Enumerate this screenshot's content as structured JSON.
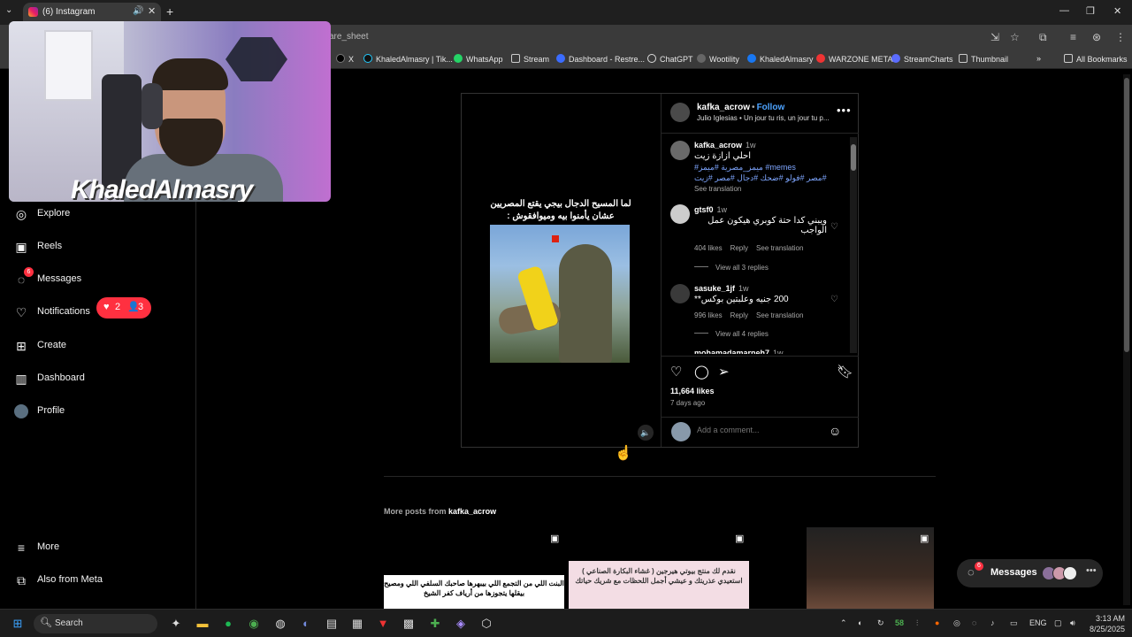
{
  "browser": {
    "tab_title": "(6) Instagram",
    "url_fragment": "are_sheet",
    "bookmarks": [
      "X",
      "KhaledAlmasry | Tik...",
      "WhatsApp",
      "Stream",
      "Dashboard - Restre...",
      "ChatGPT",
      "Wootility",
      "KhaledAlmasry",
      "WARZONE META",
      "StreamCharts",
      "Thumbnail"
    ],
    "all_bookmarks": "All Bookmarks"
  },
  "webcam": {
    "overlay_name": "KhaledAlmasry"
  },
  "sidebar": {
    "items": [
      {
        "label": "Explore",
        "icon": "compass-icon"
      },
      {
        "label": "Reels",
        "icon": "reels-icon"
      },
      {
        "label": "Messages",
        "icon": "messenger-icon",
        "badge": "6"
      },
      {
        "label": "Notifications",
        "icon": "heart-icon"
      },
      {
        "label": "Create",
        "icon": "plus-square-icon"
      },
      {
        "label": "Dashboard",
        "icon": "dashboard-icon"
      },
      {
        "label": "Profile",
        "icon": "avatar"
      }
    ],
    "notif_pill": {
      "likes": "2",
      "follows": "3"
    },
    "more": "More",
    "also_from_meta": "Also from Meta"
  },
  "post": {
    "media_caption": "لما المسيح الدجال بيجي يقتع المصريين عشان يأمنوا بيه وميوافقوش :",
    "author": "kafka_acrow",
    "follow": "Follow",
    "audio": "Julio Iglesias • Un jour tu ris, un jour tu p...",
    "caption": {
      "user": "kafka_acrow",
      "time": "1w",
      "text": "احلي ازازة زيت",
      "tags1": "#ميمز_مصرية #ميمز #memes",
      "tags2": "مصر #فولو #ضحك #دجال #مصر #زيت#",
      "see_translation": "See translation"
    },
    "comments": [
      {
        "user": "gtsf0",
        "time": "1w",
        "text": "ويبني كدا حتة كوبري هيكون عمل الواجب",
        "likes": "404 likes",
        "reply": "Reply",
        "translate": "See translation",
        "replies": "View all 3 replies"
      },
      {
        "user": "sasuke_1jf",
        "time": "1w",
        "text": "200 جنيه وعلبتين بوكس**",
        "likes": "996 likes",
        "reply": "Reply",
        "translate": "See translation",
        "replies": "View all 4 replies"
      },
      {
        "user": "mohamadamarneh7",
        "time": "1w"
      }
    ],
    "likes": "11,664 likes",
    "ago": "7 days ago",
    "add_comment_placeholder": "Add a comment..."
  },
  "more_posts": {
    "label": "More posts from",
    "user": "kafka_acrow",
    "thumbs": [
      {
        "text": "البنت اللي من التجمع اللي بيبهرها صاحبك السلفي اللي ومصيح بيقلها يتجوزها من أرياف كفر الشيخ"
      },
      {
        "text": "نقدم لك منتج بيوتي هيرجين ( غشاء البكارة الصناعي ) استعيدي عذريتك و عيشي أجمل اللحظات مع شريك حياتك"
      },
      {
        "text": ""
      }
    ]
  },
  "messages_float": {
    "label": "Messages",
    "badge": "6"
  },
  "taskbar": {
    "search": "Search",
    "tray": {
      "lang": "ENG",
      "temp": "58"
    },
    "time": "3:13 AM",
    "date": "8/25/2025"
  }
}
